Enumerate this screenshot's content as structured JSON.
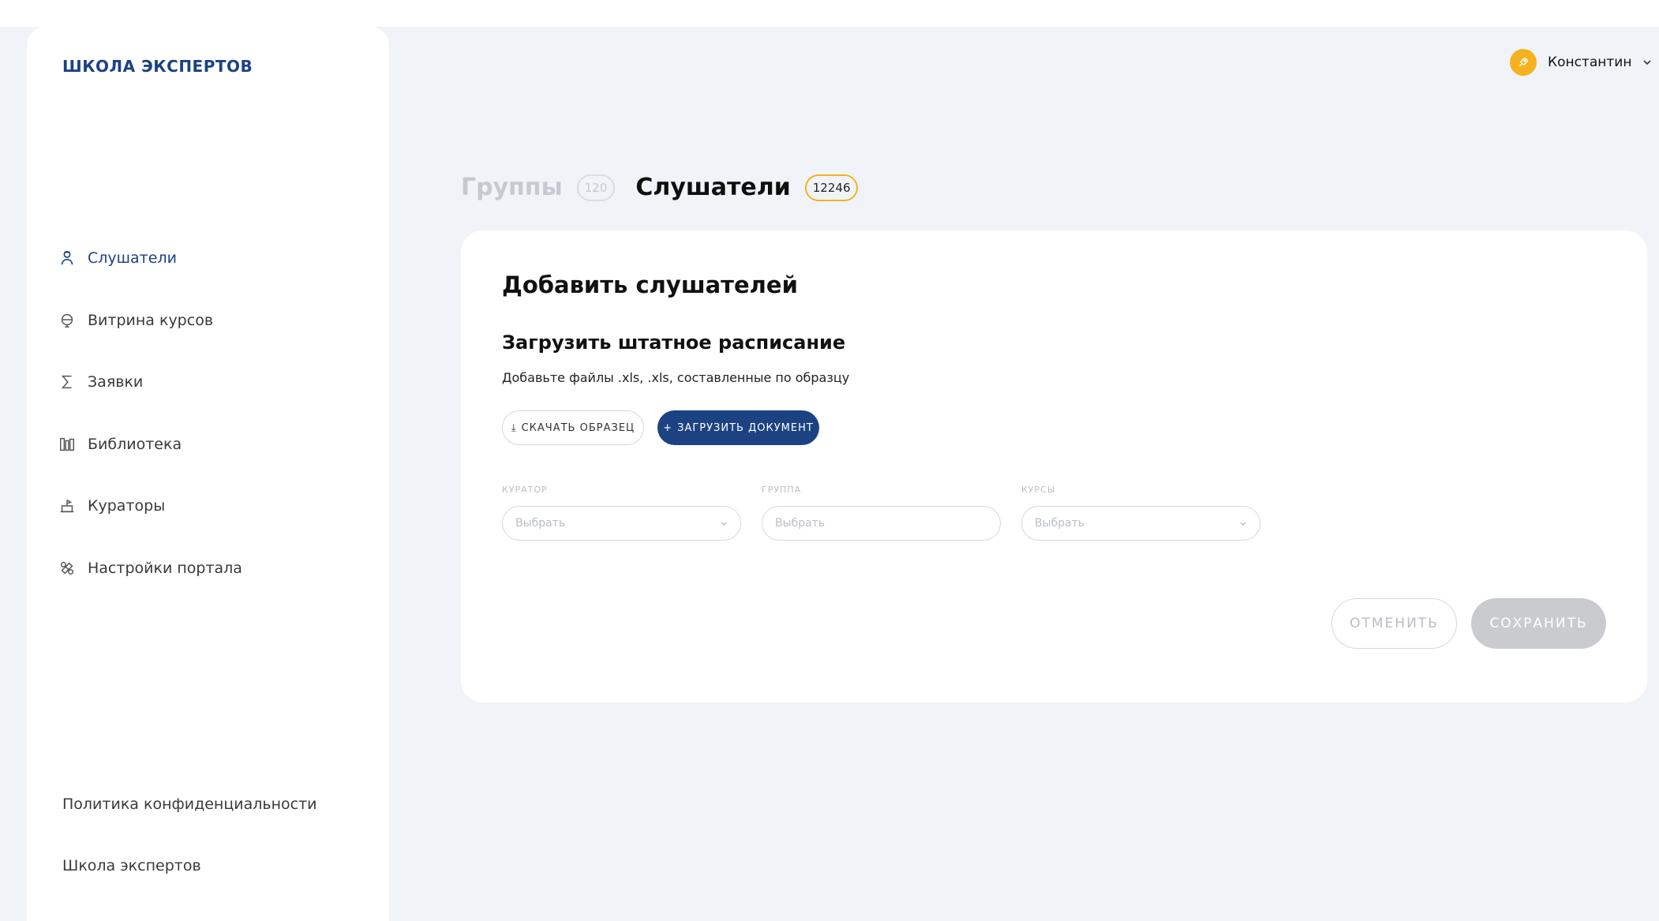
{
  "brand": {
    "logo": "Школа экспертов"
  },
  "sidebar": {
    "items": [
      {
        "label": "Слушатели",
        "icon": "listeners-icon",
        "active": true
      },
      {
        "label": "Витрина курсов",
        "icon": "courses-showcase-icon",
        "active": false
      },
      {
        "label": "Заявки",
        "icon": "sigma-icon",
        "active": false
      },
      {
        "label": "Библиотека",
        "icon": "library-icon",
        "active": false
      },
      {
        "label": "Кураторы",
        "icon": "curators-icon",
        "active": false
      },
      {
        "label": "Настройки портала",
        "icon": "settings-icon",
        "active": false
      }
    ],
    "footer": [
      {
        "label": "Политика конфиденциальности"
      },
      {
        "label": "Школа экспертов"
      }
    ]
  },
  "user": {
    "name": "Константин",
    "avatar_icon": "rocket-icon"
  },
  "tabs": [
    {
      "label": "Группы",
      "count": "120",
      "active": false
    },
    {
      "label": "Слушатели",
      "count": "12246",
      "active": true
    }
  ],
  "card": {
    "title": "Добавить слушателей",
    "section_title": "Загрузить штатное расписание",
    "section_desc": "Добавьте файлы .xls, .xls, составленные по образцу",
    "download_btn": "СКАЧАТЬ ОБРАЗЕЦ",
    "upload_btn": "ЗАГРУЗИТЬ ДОКУМЕНТ",
    "fields": [
      {
        "label": "КУРАТОР",
        "placeholder": "Выбрать",
        "has_chevron": true
      },
      {
        "label": "ГРУППА",
        "placeholder": "Выбрать",
        "has_chevron": false
      },
      {
        "label": "КУРСЫ",
        "placeholder": "Выбрать",
        "has_chevron": true
      }
    ],
    "cancel_btn": "ОТМЕНИТЬ",
    "save_btn": "СОХРАНИТЬ"
  },
  "colors": {
    "brand": "#1d4282",
    "accent": "#f5b21e",
    "background": "#f0f4f8",
    "disabled": "#c9cbce"
  }
}
